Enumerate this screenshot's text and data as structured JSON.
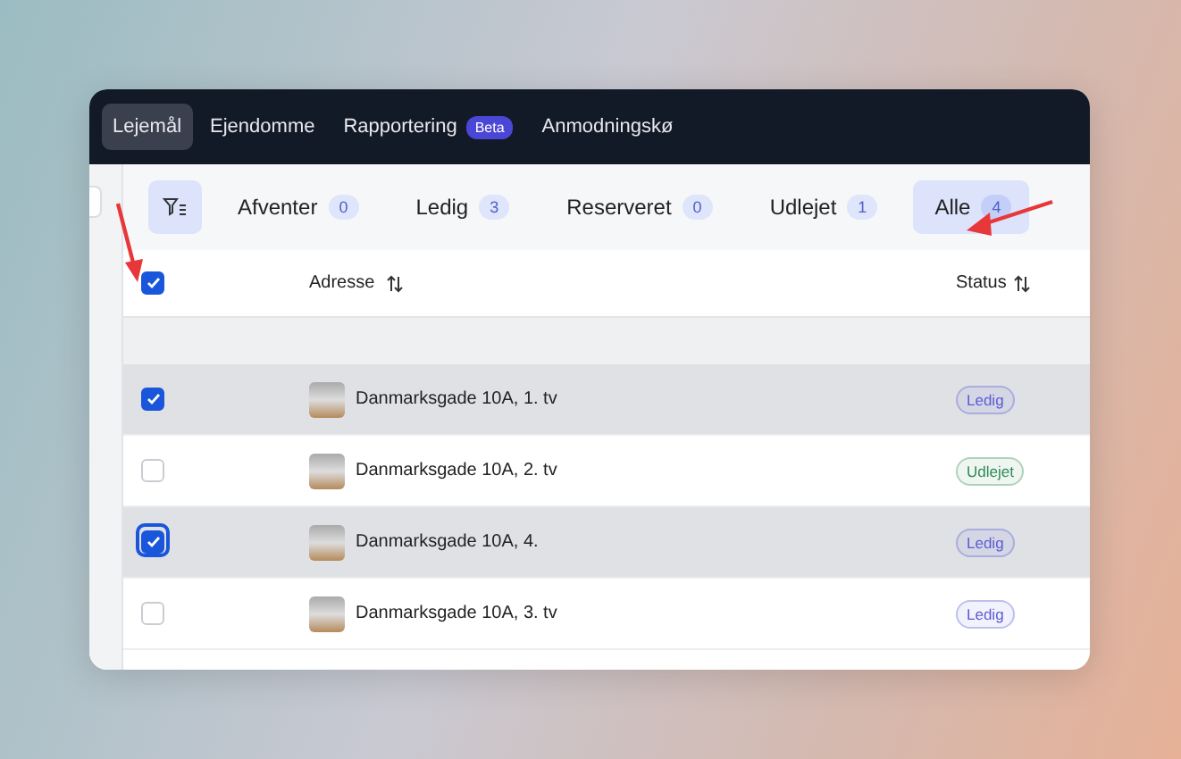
{
  "nav": {
    "items": [
      {
        "label": "Lejemål",
        "selected": true
      },
      {
        "label": "Ejendomme",
        "selected": false
      },
      {
        "label": "Rapportering",
        "selected": false,
        "badge": "Beta"
      },
      {
        "label": "Anmodningskø",
        "selected": false
      }
    ]
  },
  "filters": {
    "tabs": [
      {
        "label": "Afventer",
        "count": "0",
        "selected": false
      },
      {
        "label": "Ledig",
        "count": "3",
        "selected": false
      },
      {
        "label": "Reserveret",
        "count": "0",
        "selected": false
      },
      {
        "label": "Udlejet",
        "count": "1",
        "selected": false
      },
      {
        "label": "Alle",
        "count": "4",
        "selected": true
      }
    ]
  },
  "table": {
    "select_all": {
      "checked": true
    },
    "columns": [
      "Adresse",
      "Status"
    ],
    "rows": [
      {
        "address": "Danmarksgade 10A, 1. tv",
        "status": "Ledig",
        "color": "#5b5bd6",
        "checked": true,
        "focused": false
      },
      {
        "address": "Danmarksgade 10A, 2. tv",
        "status": "Udlejet",
        "color": "#2f8a55",
        "checked": false,
        "focused": false
      },
      {
        "address": "Danmarksgade 10A, 4.",
        "status": "Ledig",
        "color": "#5b5bd6",
        "checked": true,
        "focused": true
      },
      {
        "address": "Danmarksgade 10A, 3. tv",
        "status": "Ledig",
        "color": "#5b5bd6",
        "checked": false,
        "focused": false
      }
    ]
  }
}
